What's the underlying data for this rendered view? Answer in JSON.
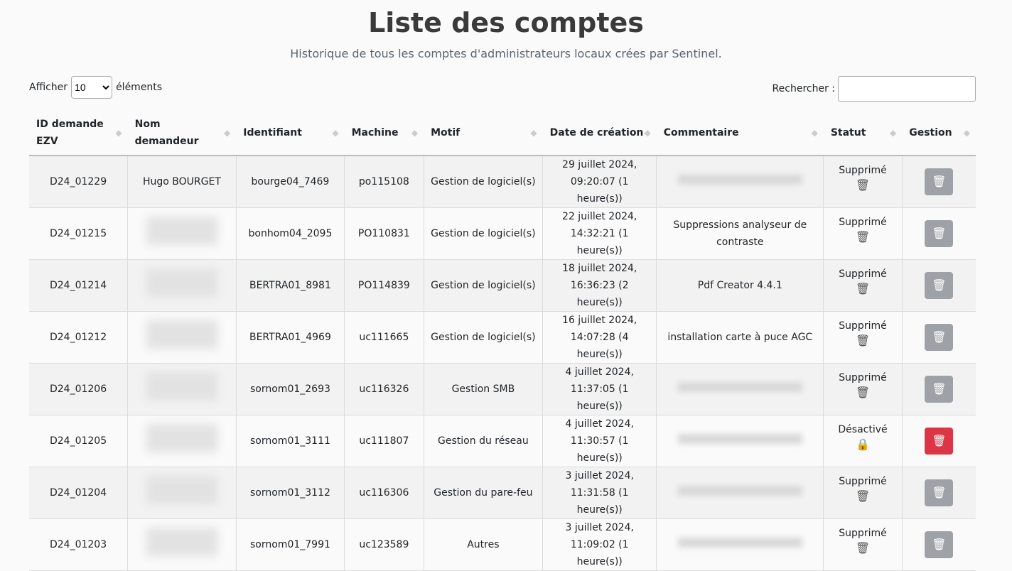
{
  "title": "Liste des comptes",
  "subtitle": "Historique de tous les comptes d'administrateurs locaux crées par Sentinel.",
  "length": {
    "prefix": "Afficher",
    "value": "10",
    "suffix": "éléments"
  },
  "search": {
    "label": "Rechercher :",
    "value": ""
  },
  "columns": [
    "ID demande EZV",
    "Nom demandeur",
    "Identifiant",
    "Machine",
    "Motif",
    "Date de création",
    "Commentaire",
    "Statut",
    "Gestion"
  ],
  "rows": [
    {
      "id": "D24_01229",
      "nom": "Hugo BOURGET",
      "ident": "bourge04_7469",
      "machine": "po115108",
      "motif": "Gestion de logiciel(s)",
      "date1": "29 juillet 2024,",
      "date2": "09:20:07 (1 heure(s))",
      "comment": null,
      "statut": "Supprimé",
      "icon": "trash-can-icon",
      "active": false
    },
    {
      "id": "D24_01215",
      "nom": null,
      "ident": "bonhom04_2095",
      "machine": "PO110831",
      "motif": "Gestion de logiciel(s)",
      "date1": "22 juillet 2024,",
      "date2": "14:32:21 (1 heure(s))",
      "comment": "Suppressions analyseur de contraste",
      "statut": "Supprimé",
      "icon": "trash-can-icon",
      "active": false
    },
    {
      "id": "D24_01214",
      "nom": null,
      "ident": "BERTRA01_8981",
      "machine": "PO114839",
      "motif": "Gestion de logiciel(s)",
      "date1": "18 juillet 2024,",
      "date2": "16:36:23 (2 heure(s))",
      "comment": "Pdf Creator 4.4.1",
      "statut": "Supprimé",
      "icon": "trash-can-icon",
      "active": false
    },
    {
      "id": "D24_01212",
      "nom": null,
      "ident": "BERTRA01_4969",
      "machine": "uc111665",
      "motif": "Gestion de logiciel(s)",
      "date1": "16 juillet 2024,",
      "date2": "14:07:28 (4 heure(s))",
      "comment": "installation carte à puce AGC",
      "statut": "Supprimé",
      "icon": "trash-can-icon",
      "active": false
    },
    {
      "id": "D24_01206",
      "nom": null,
      "ident": "sornom01_2693",
      "machine": "uc116326",
      "motif": "Gestion SMB",
      "date1": "4 juillet 2024,",
      "date2": "11:37:05 (1 heure(s))",
      "comment": null,
      "statut": "Supprimé",
      "icon": "trash-can-icon",
      "active": false
    },
    {
      "id": "D24_01205",
      "nom": null,
      "ident": "sornom01_3111",
      "machine": "uc111807",
      "motif": "Gestion du réseau",
      "date1": "4 juillet 2024,",
      "date2": "11:30:57 (1 heure(s))",
      "comment": null,
      "statut": "Désactivé",
      "icon": "lock-icon",
      "active": true
    },
    {
      "id": "D24_01204",
      "nom": null,
      "ident": "sornom01_3112",
      "machine": "uc116306",
      "motif": "Gestion du pare-feu",
      "date1": "3 juillet 2024,",
      "date2": "11:31:58 (1 heure(s))",
      "comment": null,
      "statut": "Supprimé",
      "icon": "trash-can-icon",
      "active": false
    },
    {
      "id": "D24_01203",
      "nom": null,
      "ident": "sornom01_7991",
      "machine": "uc123589",
      "motif": "Autres",
      "date1": "3 juillet 2024,",
      "date2": "11:09:02 (1 heure(s))",
      "comment": null,
      "statut": "Supprimé",
      "icon": "trash-can-icon",
      "active": false
    }
  ],
  "colors": {
    "delete_active": "#dc3545",
    "delete_disabled": "#9ea2a7"
  }
}
